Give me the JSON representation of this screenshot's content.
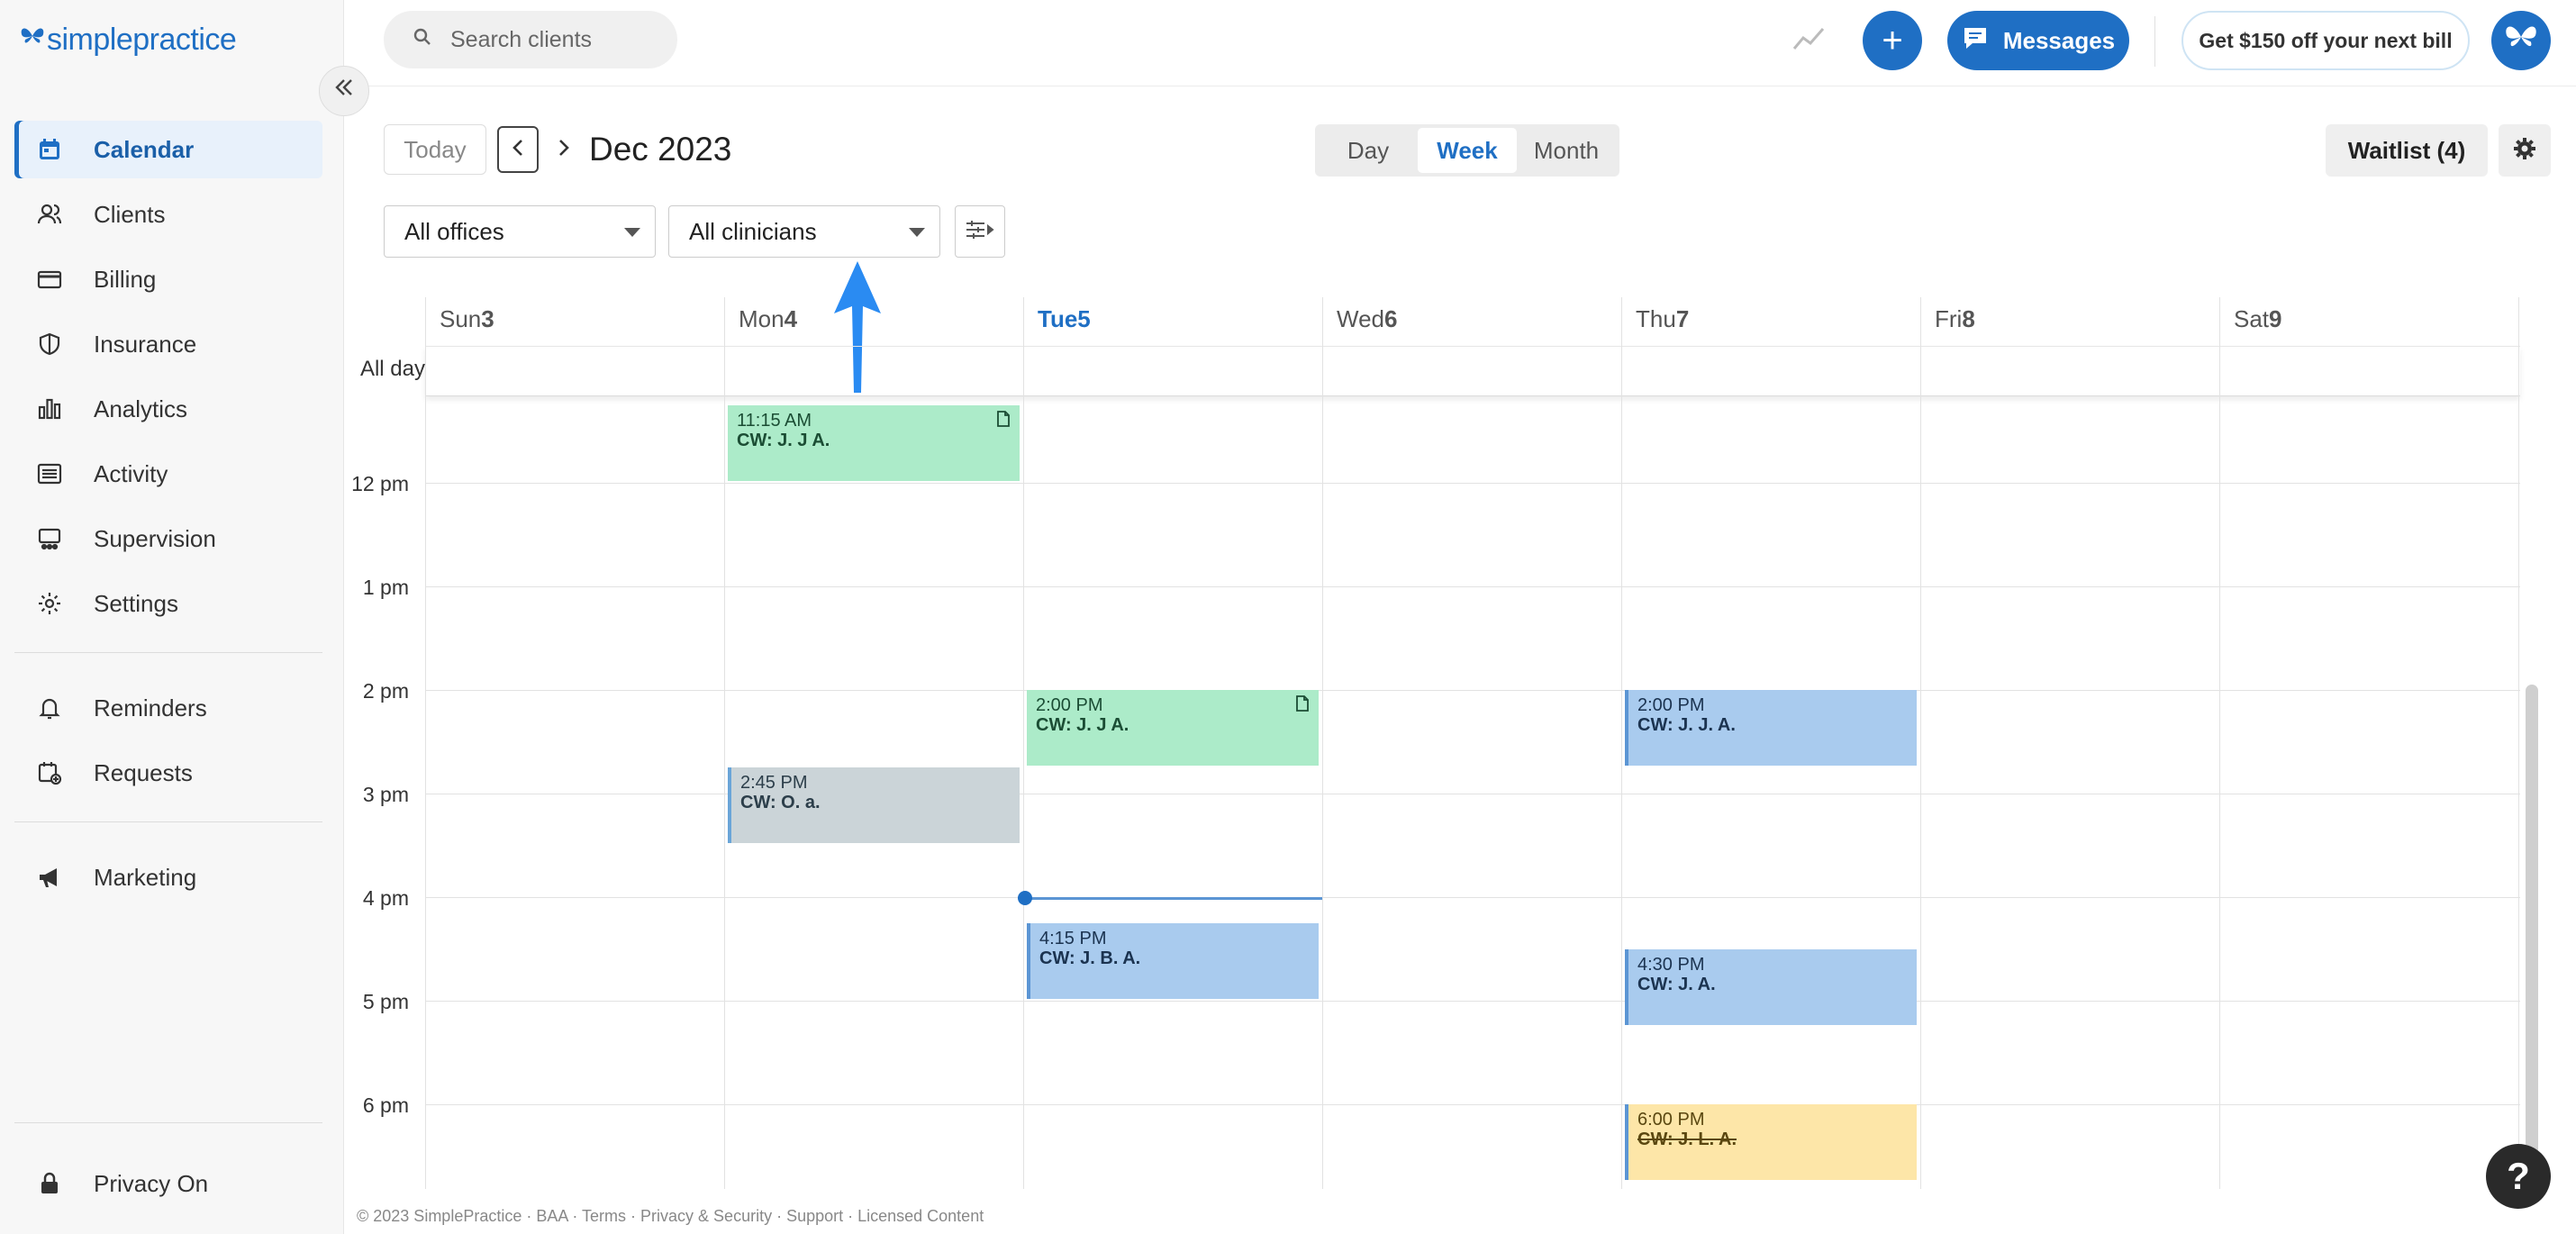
{
  "brand": {
    "logo_light": "simple",
    "logo_bold": "practice",
    "color": "#1f6fc4"
  },
  "sidebar": {
    "items": [
      {
        "label": "Calendar",
        "icon": "calendar-icon",
        "active": true
      },
      {
        "label": "Clients",
        "icon": "users-icon"
      },
      {
        "label": "Billing",
        "icon": "credit-card-icon"
      },
      {
        "label": "Insurance",
        "icon": "shield-icon"
      },
      {
        "label": "Analytics",
        "icon": "bar-chart-icon"
      },
      {
        "label": "Activity",
        "icon": "list-icon"
      },
      {
        "label": "Supervision",
        "icon": "supervision-icon"
      },
      {
        "label": "Settings",
        "icon": "gear-icon"
      }
    ],
    "secondary": [
      {
        "label": "Reminders",
        "icon": "bell-icon"
      },
      {
        "label": "Requests",
        "icon": "calendar-plus-icon"
      }
    ],
    "tertiary": [
      {
        "label": "Marketing",
        "icon": "megaphone-icon"
      }
    ],
    "privacy_label": "Privacy On"
  },
  "topbar": {
    "search_placeholder": "Search clients",
    "plus_label": "+",
    "messages_label": "Messages",
    "promo_label": "Get $150 off your next bill"
  },
  "toolbar": {
    "today_label": "Today",
    "date_title": "Dec 2023",
    "views": [
      "Day",
      "Week",
      "Month"
    ],
    "active_view": "Week",
    "waitlist_label": "Waitlist (4)",
    "offices_value": "All offices",
    "clinicians_value": "All clinicians"
  },
  "calendar": {
    "days": [
      {
        "name": "Sun",
        "num": "3"
      },
      {
        "name": "Mon",
        "num": "4"
      },
      {
        "name": "Tue",
        "num": "5",
        "today": true
      },
      {
        "name": "Wed",
        "num": "6"
      },
      {
        "name": "Thu",
        "num": "7"
      },
      {
        "name": "Fri",
        "num": "8"
      },
      {
        "name": "Sat",
        "num": "9"
      }
    ],
    "all_day_label": "All day",
    "time_labels": [
      "12 pm",
      "1 pm",
      "2 pm",
      "3 pm",
      "4 pm",
      "5 pm",
      "6 pm"
    ],
    "events": [
      {
        "day": 1,
        "time": "11:15 AM",
        "name": "CW: J. J A.",
        "color": "green",
        "note": true
      },
      {
        "day": 1,
        "time": "2:45 PM",
        "name": "CW: O. a.",
        "color": "gray"
      },
      {
        "day": 2,
        "time": "2:00 PM",
        "name": "CW: J. J A.",
        "color": "green",
        "note": true
      },
      {
        "day": 2,
        "time": "4:15 PM",
        "name": "CW: J. B. A.",
        "color": "blue"
      },
      {
        "day": 4,
        "time": "2:00 PM",
        "name": "CW: J. J. A.",
        "color": "blue"
      },
      {
        "day": 4,
        "time": "4:30 PM",
        "name": "CW: J. A.",
        "color": "blue"
      },
      {
        "day": 4,
        "time": "6:00 PM",
        "name": "CW: J. L. A.",
        "color": "yellow",
        "cancelled": true
      }
    ]
  },
  "footer": {
    "text": "© 2023 SimplePractice · BAA · Terms · Privacy & Security · Support · Licensed Content"
  },
  "help_label": "?"
}
